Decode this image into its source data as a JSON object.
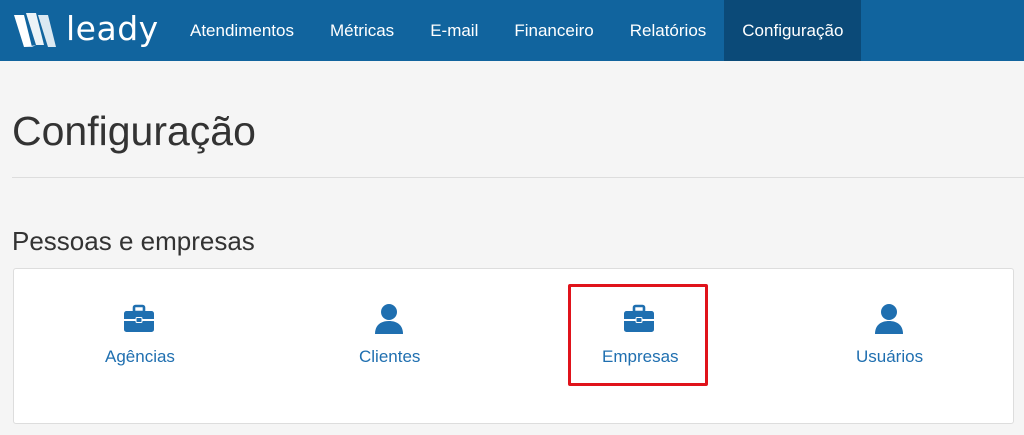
{
  "brand": {
    "name": "leady"
  },
  "nav": {
    "items": [
      {
        "label": "Atendimentos"
      },
      {
        "label": "Métricas"
      },
      {
        "label": "E-mail"
      },
      {
        "label": "Financeiro"
      },
      {
        "label": "Relatórios"
      },
      {
        "label": "Configuração"
      }
    ],
    "active": "Configuração"
  },
  "page": {
    "title": "Configuração"
  },
  "section": {
    "title": "Pessoas e empresas",
    "tiles": [
      {
        "label": "Agências",
        "icon": "briefcase-icon"
      },
      {
        "label": "Clientes",
        "icon": "user-icon"
      },
      {
        "label": "Empresas",
        "icon": "briefcase-icon",
        "highlighted": true
      },
      {
        "label": "Usuários",
        "icon": "user-icon"
      }
    ]
  },
  "colors": {
    "navbar": "#11649e",
    "nav_active": "#0b4a78",
    "link": "#1f6fb0",
    "highlight": "#e0131b"
  }
}
